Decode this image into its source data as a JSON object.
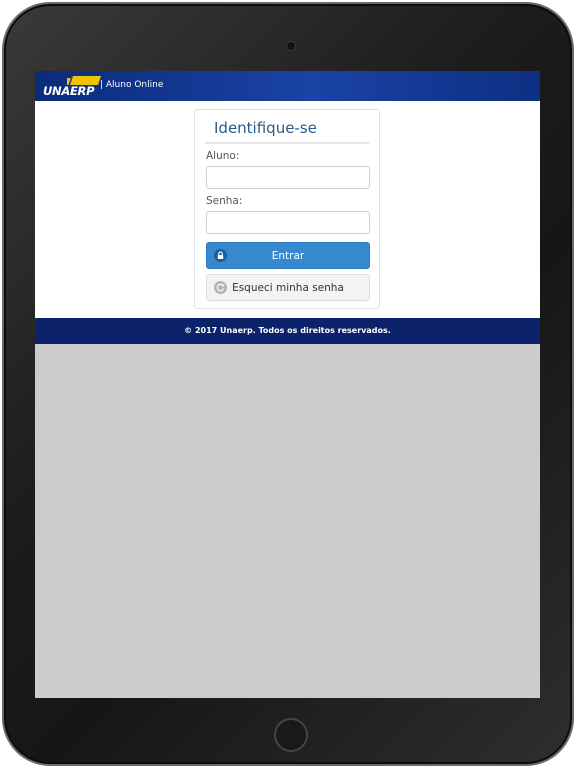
{
  "header": {
    "logo_text": "UNAERP",
    "title": "| Aluno Online"
  },
  "login": {
    "title": "Identifique-se",
    "username_label": "Aluno:",
    "username_value": "",
    "password_label": "Senha:",
    "password_value": "",
    "submit_label": "Entrar",
    "submit_icon": "lock-icon",
    "forgot_label": "Esqueci minha senha",
    "forgot_icon": "refresh-icon"
  },
  "footer": {
    "copyright": "© 2017 Unaerp. Todos os direitos reservados."
  },
  "colors": {
    "header_blue": "#1a43a6",
    "footer_navy": "#0c236b",
    "primary_button": "#3688cf",
    "title_blue": "#2a5a8a",
    "logo_yellow": "#f2c400",
    "screen_gray": "#cccccc"
  }
}
